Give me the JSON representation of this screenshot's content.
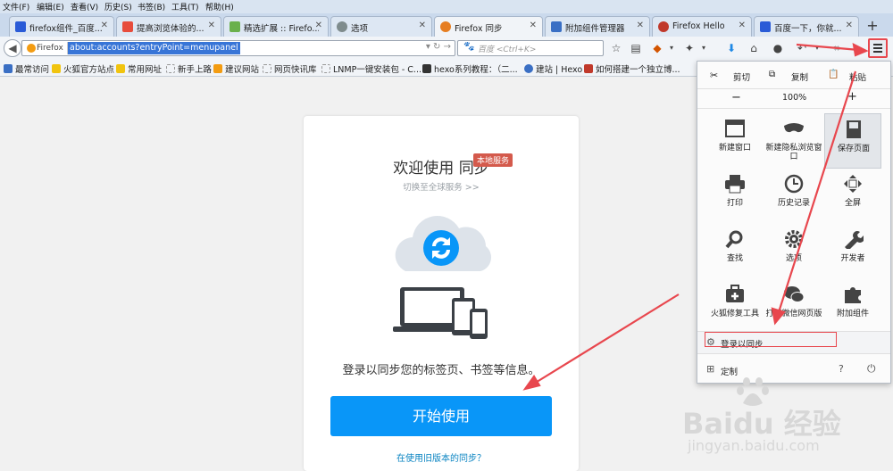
{
  "menubar": [
    "文件(F)",
    "编辑(E)",
    "查看(V)",
    "历史(S)",
    "书签(B)",
    "工具(T)",
    "帮助(H)"
  ],
  "tabs": [
    {
      "label": "firefox组件_百度...",
      "color": "#2a5bd7"
    },
    {
      "label": "提高浏览体验的...",
      "color": "#e74c3c"
    },
    {
      "label": "精选扩展 :: Firefo...",
      "color": "#6ab04c"
    },
    {
      "label": "选项",
      "color": "#7f8c8d"
    },
    {
      "label": "Firefox 同步",
      "color": "#e67e22",
      "active": true
    },
    {
      "label": "附加组件管理器",
      "color": "#3a6fc4"
    },
    {
      "label": "Firefox Hello",
      "color": "#c0392b"
    },
    {
      "label": "百度一下，你就...",
      "color": "#2a5bd7"
    }
  ],
  "navbar": {
    "identity": "Firefox",
    "url": "about:accounts?entryPoint=menupanel",
    "search_placeholder": "百度 <Ctrl+K>"
  },
  "bookmarks": [
    {
      "label": "最常访问",
      "color": "#3a6fc4"
    },
    {
      "label": "火狐官方站点",
      "color": "#f1c40f"
    },
    {
      "label": "常用网址",
      "color": "#f1c40f"
    },
    {
      "label": "新手上路",
      "color": "#ccc"
    },
    {
      "label": "建议网站",
      "color": "#f39c12"
    },
    {
      "label": "网页快讯库",
      "color": "#ccc"
    },
    {
      "label": "LNMP一键安装包 - C...",
      "color": "#ccc"
    },
    {
      "label": "hexo系列教程：（二...",
      "color": "#333"
    },
    {
      "label": "建站 | Hexo",
      "color": "#3a6fc4"
    },
    {
      "label": "如何搭建一个独立博...",
      "color": "#c0392b"
    }
  ],
  "sync": {
    "title": "欢迎使用 同步",
    "badge": "本地服务",
    "switch": "切换至全球服务 >>",
    "desc": "登录以同步您的标签页、书签等信息。",
    "start": "开始使用",
    "old_link": "在使用旧版本的同步？"
  },
  "panel": {
    "cut": "剪切",
    "copy": "复制",
    "paste": "粘贴",
    "zoom_out": "−",
    "zoom": "100%",
    "zoom_in": "+",
    "items": [
      {
        "label": "新建窗口",
        "icon": "new-window-icon"
      },
      {
        "label": "新建隐私浏览窗口",
        "icon": "private-mask-icon"
      },
      {
        "label": "保存页面",
        "icon": "save-page-icon"
      },
      {
        "label": "打印",
        "icon": "printer-icon"
      },
      {
        "label": "历史记录",
        "icon": "history-clock-icon"
      },
      {
        "label": "全屏",
        "icon": "fullscreen-icon"
      },
      {
        "label": "查找",
        "icon": "find-magnifier-icon"
      },
      {
        "label": "选项",
        "icon": "options-gear-icon"
      },
      {
        "label": "开发者",
        "icon": "developer-wrench-icon"
      },
      {
        "label": "火狐修复工具",
        "icon": "repair-kit-icon"
      },
      {
        "label": "打开微信网页版",
        "icon": "wechat-icon"
      },
      {
        "label": "附加组件",
        "icon": "addons-puzzle-icon"
      }
    ],
    "signin": "登录以同步",
    "customize": "定制"
  },
  "watermark": {
    "brand": "Baidu 经验",
    "url": "jingyan.baidu.com"
  },
  "colors": {
    "accent_blue": "#0996f8",
    "highlight_red": "#e8474e"
  }
}
